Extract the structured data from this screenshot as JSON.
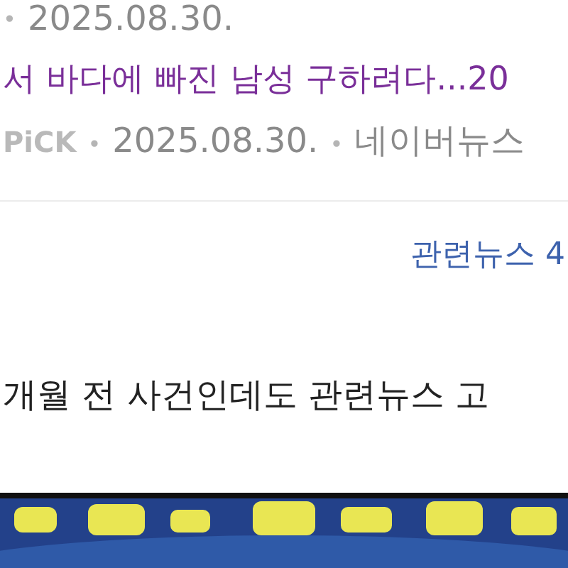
{
  "top_meta": {
    "separator": "•",
    "date": "2025.08.30."
  },
  "news_item": {
    "title": "서 바다에 빠진 남성 구하려다...20",
    "badge": "PiCK",
    "separator": "•",
    "date": "2025.08.30.",
    "source": "네이버뉴스"
  },
  "related_news_link": "관련뉴스 4",
  "post_text": "개월 전 사건인데도 관련뉴스 고"
}
